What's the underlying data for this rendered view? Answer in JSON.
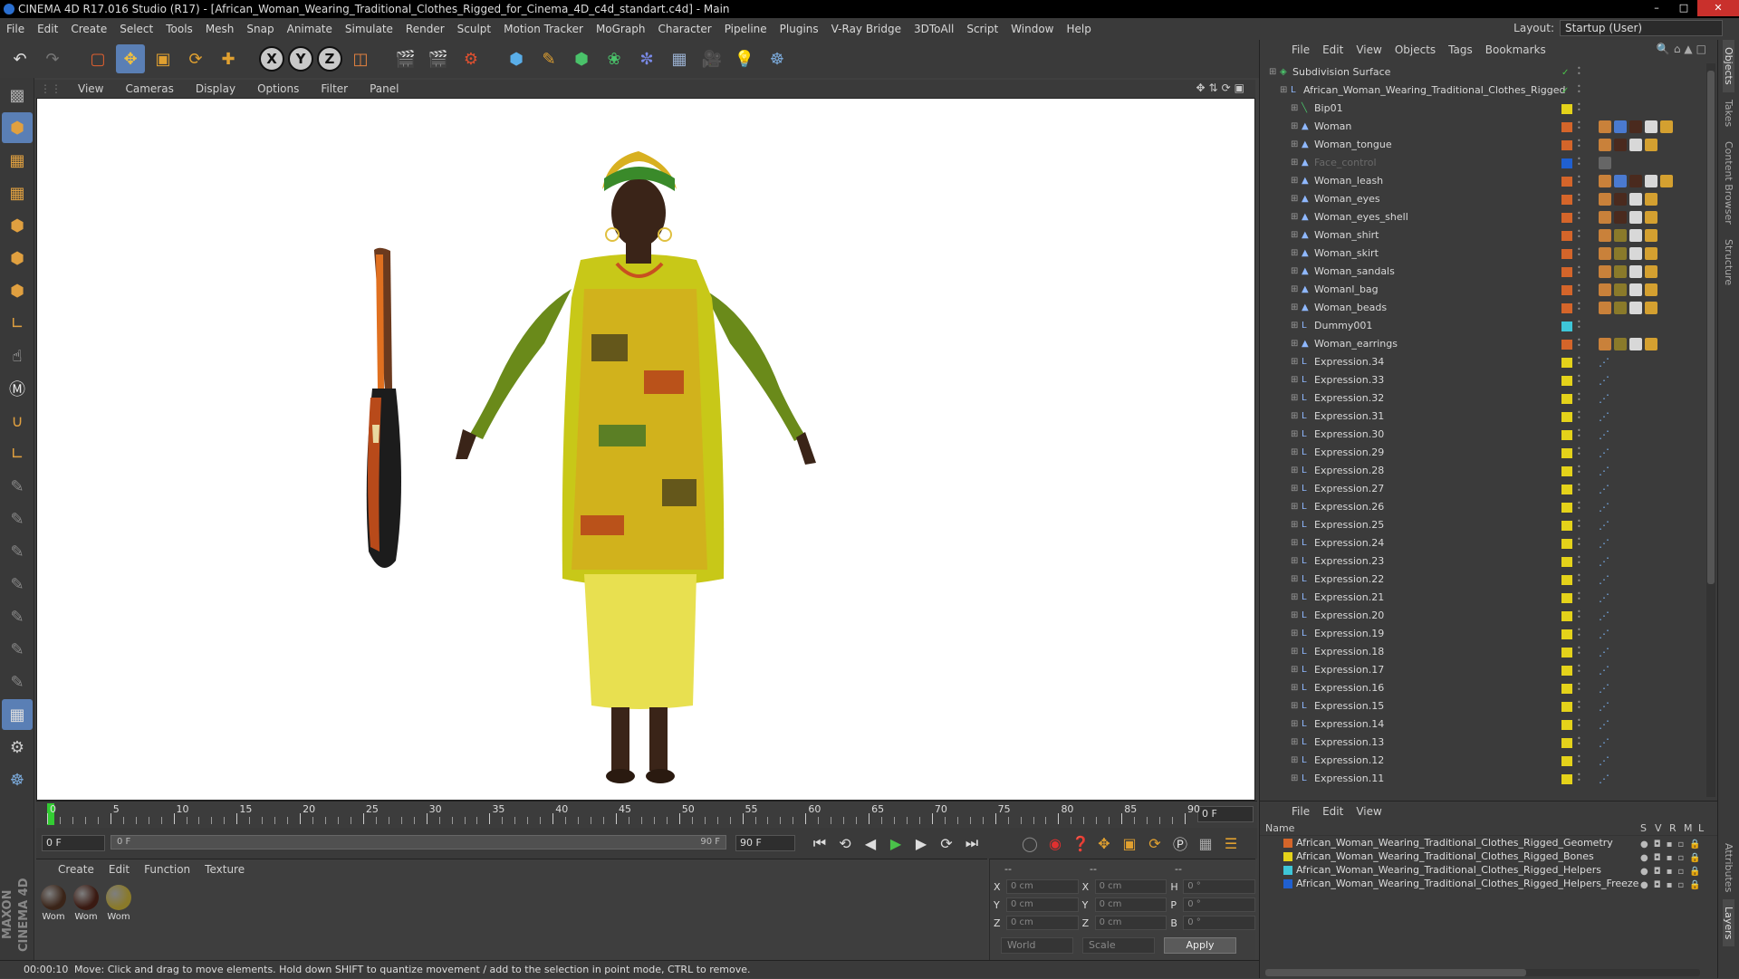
{
  "window": {
    "title": "CINEMA 4D R17.016 Studio (R17) - [African_Woman_Wearing_Traditional_Clothes_Rigged_for_Cinema_4D_c4d_standart.c4d] - Main"
  },
  "menubar": {
    "items": [
      "File",
      "Edit",
      "Create",
      "Select",
      "Tools",
      "Mesh",
      "Snap",
      "Animate",
      "Simulate",
      "Render",
      "Sculpt",
      "Motion Tracker",
      "MoGraph",
      "Character",
      "Pipeline",
      "Plugins",
      "V-Ray Bridge",
      "3DToAll",
      "Script",
      "Window",
      "Help"
    ],
    "layout_label": "Layout:",
    "layout_value": "Startup (User)"
  },
  "toolbar": {
    "axis_x": "X",
    "axis_y": "Y",
    "axis_z": "Z"
  },
  "viewport": {
    "menu": [
      "View",
      "Cameras",
      "Display",
      "Options",
      "Filter",
      "Panel"
    ],
    "background": "#ffffff"
  },
  "timeline": {
    "ticks": [
      0,
      5,
      10,
      15,
      20,
      25,
      30,
      35,
      40,
      45,
      50,
      55,
      60,
      65,
      70,
      75,
      80,
      85,
      90
    ],
    "end_field": "0 F",
    "current_frame_field": "0 F",
    "slider_start": "0 F",
    "slider_end": "90 F",
    "max_frame_field": "90 F"
  },
  "materials": {
    "menu": [
      "Create",
      "Edit",
      "Function",
      "Texture"
    ],
    "items": [
      {
        "label": "Wom",
        "color": "#3a2418"
      },
      {
        "label": "Wom",
        "color": "#3a1a12"
      },
      {
        "label": "Wom",
        "color": "#8a7a2a"
      }
    ]
  },
  "coordinates": {
    "header_dashes": "--",
    "rows": [
      {
        "a_label": "X",
        "a_val": "0 cm",
        "b_label": "X",
        "b_val": "0 cm",
        "c_label": "H",
        "c_val": "0 °"
      },
      {
        "a_label": "Y",
        "a_val": "0 cm",
        "b_label": "Y",
        "b_val": "0 cm",
        "c_label": "P",
        "c_val": "0 °"
      },
      {
        "a_label": "Z",
        "a_val": "0 cm",
        "b_label": "Z",
        "b_val": "0 cm",
        "c_label": "B",
        "c_val": "0 °"
      }
    ],
    "mode_world": "World",
    "mode_scale": "Scale",
    "apply_label": "Apply"
  },
  "status": {
    "time": "00:00:10",
    "message": "Move: Click and drag to move elements. Hold down SHIFT to quantize movement / add to the selection in point mode, CTRL to remove."
  },
  "maxon_logo": "MAXON CINEMA 4D",
  "objects_panel": {
    "menu": [
      "File",
      "Edit",
      "View",
      "Objects",
      "Tags",
      "Bookmarks"
    ],
    "rows": [
      {
        "name": "Subdivision Surface",
        "indent": 0,
        "icon": "subdivision-icon",
        "layer": "",
        "tags": []
      },
      {
        "name": "African_Woman_Wearing_Traditional_Clothes_Rigged",
        "indent": 1,
        "icon": "null-icon",
        "layer": "",
        "tags": []
      },
      {
        "name": "Bip01",
        "indent": 2,
        "icon": "bone-icon",
        "layer": "#e4d21a",
        "tags": []
      },
      {
        "name": "Woman",
        "indent": 2,
        "icon": "mesh-icon",
        "layer": "#d4652a",
        "tags": [
          "#c9813a",
          "#4a7ad0",
          "#4a2a1e",
          "#d8d8d8",
          "#d4a030"
        ]
      },
      {
        "name": "Woman_tongue",
        "indent": 2,
        "icon": "mesh-icon",
        "layer": "#d4652a",
        "tags": [
          "#c9813a",
          "#4a2a1e",
          "#d8d8d8",
          "#d4a030"
        ]
      },
      {
        "name": "Face_control",
        "indent": 2,
        "icon": "mesh-icon",
        "layer": "#2060d0",
        "tags": [
          "#666666"
        ],
        "dim": true
      },
      {
        "name": "Woman_leash",
        "indent": 2,
        "icon": "mesh-icon",
        "layer": "#d4652a",
        "tags": [
          "#c9813a",
          "#4a7ad0",
          "#4a2a1e",
          "#d8d8d8",
          "#d4a030"
        ]
      },
      {
        "name": "Woman_eyes",
        "indent": 2,
        "icon": "mesh-icon",
        "layer": "#d4652a",
        "tags": [
          "#c9813a",
          "#4a2a1e",
          "#d8d8d8",
          "#d4a030"
        ]
      },
      {
        "name": "Woman_eyes_shell",
        "indent": 2,
        "icon": "mesh-icon",
        "layer": "#d4652a",
        "tags": [
          "#c9813a",
          "#4a2a1e",
          "#d8d8d8",
          "#d4a030"
        ]
      },
      {
        "name": "Woman_shirt",
        "indent": 2,
        "icon": "mesh-icon",
        "layer": "#d4652a",
        "tags": [
          "#c9813a",
          "#8a7a2a",
          "#d8d8d8",
          "#d4a030"
        ]
      },
      {
        "name": "Woman_skirt",
        "indent": 2,
        "icon": "mesh-icon",
        "layer": "#d4652a",
        "tags": [
          "#c9813a",
          "#8a7a2a",
          "#d8d8d8",
          "#d4a030"
        ]
      },
      {
        "name": "Woman_sandals",
        "indent": 2,
        "icon": "mesh-icon",
        "layer": "#d4652a",
        "tags": [
          "#c9813a",
          "#8a7a2a",
          "#d8d8d8",
          "#d4a030"
        ]
      },
      {
        "name": "Womanl_bag",
        "indent": 2,
        "icon": "mesh-icon",
        "layer": "#d4652a",
        "tags": [
          "#c9813a",
          "#8a7a2a",
          "#d8d8d8",
          "#d4a030"
        ]
      },
      {
        "name": "Woman_beads",
        "indent": 2,
        "icon": "mesh-icon",
        "layer": "#d4652a",
        "tags": [
          "#c9813a",
          "#8a7a2a",
          "#d8d8d8",
          "#d4a030"
        ]
      },
      {
        "name": "Dummy001",
        "indent": 2,
        "icon": "null-icon",
        "layer": "#3ec6d8",
        "tags": []
      },
      {
        "name": "Woman_earrings",
        "indent": 2,
        "icon": "mesh-icon",
        "layer": "#d4652a",
        "tags": [
          "#c9813a",
          "#8a7a2a",
          "#d8d8d8",
          "#d4a030"
        ]
      },
      {
        "name": "Expression.34",
        "indent": 2,
        "icon": "null-icon",
        "layer": "#e4d21a",
        "tags": [
          "xpresso"
        ]
      },
      {
        "name": "Expression.33",
        "indent": 2,
        "icon": "null-icon",
        "layer": "#e4d21a",
        "tags": [
          "xpresso"
        ]
      },
      {
        "name": "Expression.32",
        "indent": 2,
        "icon": "null-icon",
        "layer": "#e4d21a",
        "tags": [
          "xpresso"
        ]
      },
      {
        "name": "Expression.31",
        "indent": 2,
        "icon": "null-icon",
        "layer": "#e4d21a",
        "tags": [
          "xpresso"
        ]
      },
      {
        "name": "Expression.30",
        "indent": 2,
        "icon": "null-icon",
        "layer": "#e4d21a",
        "tags": [
          "xpresso"
        ]
      },
      {
        "name": "Expression.29",
        "indent": 2,
        "icon": "null-icon",
        "layer": "#e4d21a",
        "tags": [
          "xpresso"
        ]
      },
      {
        "name": "Expression.28",
        "indent": 2,
        "icon": "null-icon",
        "layer": "#e4d21a",
        "tags": [
          "xpresso"
        ]
      },
      {
        "name": "Expression.27",
        "indent": 2,
        "icon": "null-icon",
        "layer": "#e4d21a",
        "tags": [
          "xpresso"
        ]
      },
      {
        "name": "Expression.26",
        "indent": 2,
        "icon": "null-icon",
        "layer": "#e4d21a",
        "tags": [
          "xpresso"
        ]
      },
      {
        "name": "Expression.25",
        "indent": 2,
        "icon": "null-icon",
        "layer": "#e4d21a",
        "tags": [
          "xpresso"
        ]
      },
      {
        "name": "Expression.24",
        "indent": 2,
        "icon": "null-icon",
        "layer": "#e4d21a",
        "tags": [
          "xpresso"
        ]
      },
      {
        "name": "Expression.23",
        "indent": 2,
        "icon": "null-icon",
        "layer": "#e4d21a",
        "tags": [
          "xpresso"
        ]
      },
      {
        "name": "Expression.22",
        "indent": 2,
        "icon": "null-icon",
        "layer": "#e4d21a",
        "tags": [
          "xpresso"
        ]
      },
      {
        "name": "Expression.21",
        "indent": 2,
        "icon": "null-icon",
        "layer": "#e4d21a",
        "tags": [
          "xpresso"
        ]
      },
      {
        "name": "Expression.20",
        "indent": 2,
        "icon": "null-icon",
        "layer": "#e4d21a",
        "tags": [
          "xpresso"
        ]
      },
      {
        "name": "Expression.19",
        "indent": 2,
        "icon": "null-icon",
        "layer": "#e4d21a",
        "tags": [
          "xpresso"
        ]
      },
      {
        "name": "Expression.18",
        "indent": 2,
        "icon": "null-icon",
        "layer": "#e4d21a",
        "tags": [
          "xpresso"
        ]
      },
      {
        "name": "Expression.17",
        "indent": 2,
        "icon": "null-icon",
        "layer": "#e4d21a",
        "tags": [
          "xpresso"
        ]
      },
      {
        "name": "Expression.16",
        "indent": 2,
        "icon": "null-icon",
        "layer": "#e4d21a",
        "tags": [
          "xpresso"
        ]
      },
      {
        "name": "Expression.15",
        "indent": 2,
        "icon": "null-icon",
        "layer": "#e4d21a",
        "tags": [
          "xpresso"
        ]
      },
      {
        "name": "Expression.14",
        "indent": 2,
        "icon": "null-icon",
        "layer": "#e4d21a",
        "tags": [
          "xpresso"
        ]
      },
      {
        "name": "Expression.13",
        "indent": 2,
        "icon": "null-icon",
        "layer": "#e4d21a",
        "tags": [
          "xpresso"
        ]
      },
      {
        "name": "Expression.12",
        "indent": 2,
        "icon": "null-icon",
        "layer": "#e4d21a",
        "tags": [
          "xpresso"
        ]
      },
      {
        "name": "Expression.11",
        "indent": 2,
        "icon": "null-icon",
        "layer": "#e4d21a",
        "tags": [
          "xpresso"
        ]
      }
    ]
  },
  "side_tabs": [
    "Objects",
    "Takes",
    "Content Browser",
    "Structure"
  ],
  "side_tabs_bottom": [
    "Attributes",
    "Layers"
  ],
  "layers_panel": {
    "menu": [
      "File",
      "Edit",
      "View"
    ],
    "columns": {
      "name": "Name",
      "s": "S",
      "v": "V",
      "r": "R",
      "m": "M",
      "l": "L"
    },
    "rows": [
      {
        "name": "African_Woman_Wearing_Traditional_Clothes_Rigged_Geometry",
        "color": "#d4652a"
      },
      {
        "name": "African_Woman_Wearing_Traditional_Clothes_Rigged_Bones",
        "color": "#e4d21a"
      },
      {
        "name": "African_Woman_Wearing_Traditional_Clothes_Rigged_Helpers",
        "color": "#3ec6d8"
      },
      {
        "name": "African_Woman_Wearing_Traditional_Clothes_Rigged_Helpers_Freeze",
        "color": "#2060d0"
      }
    ]
  }
}
